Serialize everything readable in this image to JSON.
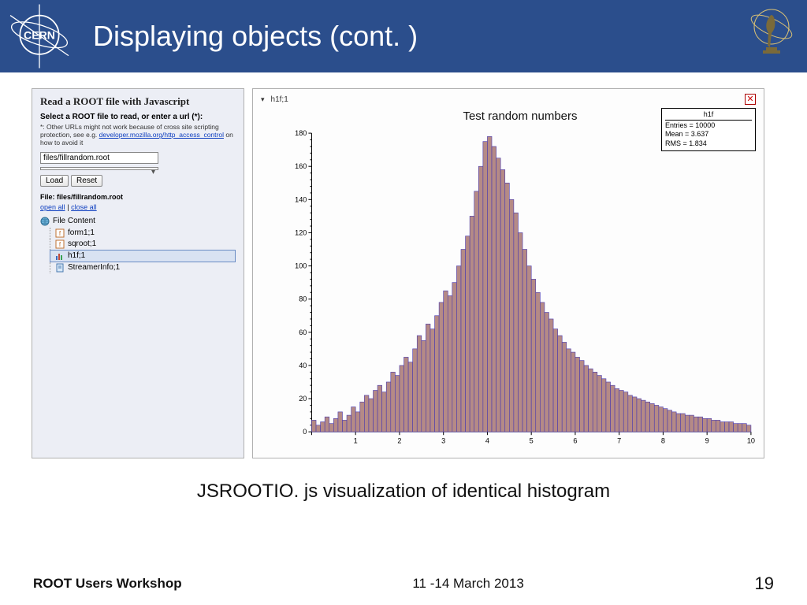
{
  "header": {
    "title": "Displaying objects (cont. )"
  },
  "left_panel": {
    "title": "Read a ROOT file with Javascript",
    "subtitle": "Select a ROOT file to read, or enter a url (*):",
    "note_prefix": "*: Other URLs might not work because of cross site scripting protection, see e.g. ",
    "note_link_text": "developer.mozilla.org/http_access_control",
    "note_suffix": " on how to avoid it",
    "url_value": "files/fillrandom.root",
    "dropdown_value": "",
    "load_label": "Load",
    "reset_label": "Reset",
    "file_label": "File: files/fillrandom.root",
    "open_all": "open all",
    "close_all": "close all",
    "tree_root": "File Content",
    "tree_items": [
      "form1;1",
      "sqroot;1",
      "h1f;1",
      "StreamerInfo;1"
    ]
  },
  "right_panel": {
    "tab_label": "h1f;1",
    "close_tooltip": "Close"
  },
  "chart_data": {
    "type": "bar",
    "title": "Test random numbers",
    "xlabel": "",
    "ylabel": "",
    "xlim": [
      0,
      10
    ],
    "ylim": [
      0,
      180
    ],
    "x_ticks": [
      0,
      1,
      2,
      3,
      4,
      5,
      6,
      7,
      8,
      9,
      10
    ],
    "y_ticks": [
      0,
      20,
      40,
      60,
      80,
      100,
      120,
      140,
      160,
      180
    ],
    "x": [
      0.1,
      0.2,
      0.3,
      0.4,
      0.5,
      0.6,
      0.7,
      0.8,
      0.9,
      1.0,
      1.1,
      1.2,
      1.3,
      1.4,
      1.5,
      1.6,
      1.7,
      1.8,
      1.9,
      2.0,
      2.1,
      2.2,
      2.3,
      2.4,
      2.5,
      2.6,
      2.7,
      2.8,
      2.9,
      3.0,
      3.1,
      3.2,
      3.3,
      3.4,
      3.5,
      3.6,
      3.7,
      3.8,
      3.9,
      4.0,
      4.1,
      4.2,
      4.3,
      4.4,
      4.5,
      4.6,
      4.7,
      4.8,
      4.9,
      5.0,
      5.1,
      5.2,
      5.3,
      5.4,
      5.5,
      5.6,
      5.7,
      5.8,
      5.9,
      6.0,
      6.1,
      6.2,
      6.3,
      6.4,
      6.5,
      6.6,
      6.7,
      6.8,
      6.9,
      7.0,
      7.1,
      7.2,
      7.3,
      7.4,
      7.5,
      7.6,
      7.7,
      7.8,
      7.9,
      8.0,
      8.1,
      8.2,
      8.3,
      8.4,
      8.5,
      8.6,
      8.7,
      8.8,
      8.9,
      9.0,
      9.1,
      9.2,
      9.3,
      9.4,
      9.5,
      9.6,
      9.7,
      9.8,
      9.9,
      10.0
    ],
    "values": [
      7,
      4,
      6,
      9,
      5,
      8,
      12,
      7,
      10,
      15,
      12,
      18,
      22,
      20,
      25,
      28,
      24,
      30,
      36,
      34,
      40,
      45,
      42,
      50,
      58,
      55,
      65,
      62,
      70,
      78,
      85,
      82,
      90,
      100,
      110,
      118,
      130,
      145,
      160,
      175,
      178,
      172,
      165,
      158,
      150,
      140,
      132,
      120,
      110,
      100,
      92,
      84,
      78,
      72,
      68,
      62,
      58,
      54,
      50,
      48,
      45,
      43,
      40,
      38,
      36,
      34,
      32,
      30,
      28,
      26,
      25,
      24,
      22,
      21,
      20,
      19,
      18,
      17,
      16,
      15,
      14,
      13,
      12,
      11,
      11,
      10,
      10,
      9,
      9,
      8,
      8,
      7,
      7,
      6,
      6,
      6,
      5,
      5,
      5,
      4
    ],
    "stat_box": {
      "name": "h1f",
      "entries": "Entries = 10000",
      "mean": "Mean = 3.637",
      "rms": "RMS = 1.834"
    }
  },
  "caption": "JSROOTIO. js visualization of identical histogram",
  "footer": {
    "left": "ROOT Users Workshop",
    "mid": "11 -14 March 2013",
    "right": "19"
  }
}
